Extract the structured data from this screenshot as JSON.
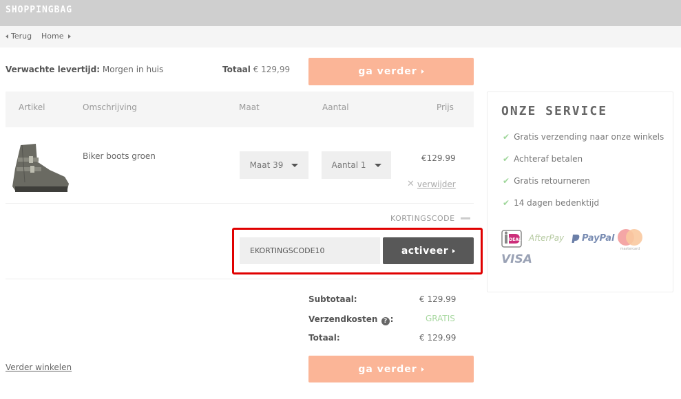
{
  "header": {
    "brand": "SHOPPINGBAG"
  },
  "breadcrumb": {
    "back_label": "Terug",
    "home_label": "Home"
  },
  "delivery": {
    "label": "Verwachte levertijd:",
    "value": " Morgen in huis"
  },
  "top_total": {
    "label": "Totaal",
    "value": " € 129,99"
  },
  "buttons": {
    "continue_label": "ga verder",
    "activate_label": "activeer"
  },
  "table": {
    "headers": [
      "Artikel",
      "Omschrijving",
      "Maat",
      "Aantal",
      "Prijs"
    ],
    "rows": [
      {
        "description": "Biker boots groen",
        "size": "Maat 39",
        "quantity": "Aantal 1",
        "price": "€129.99",
        "remove_label": "verwijder"
      }
    ]
  },
  "discount": {
    "label": "KORTINGSCODE",
    "code_value": "EKORTINGSCODE10"
  },
  "summary": {
    "subtotal_label": "Subtotaal:",
    "subtotal_value": "€ 129.99",
    "shipping_label": "Verzendkosten",
    "shipping_suffix": ":",
    "shipping_value": "GRATIS",
    "total_label": "Totaal:",
    "total_value": "€ 129.99"
  },
  "continue_shopping_label": "Verder winkelen",
  "service": {
    "title": "ONZE SERVICE",
    "items": [
      "Gratis verzending naar onze winkels",
      "Achteraf betalen",
      "Gratis retourneren",
      "14 dagen bedenktijd"
    ]
  },
  "payment_logos": {
    "ideal": "iDEAL",
    "afterpay": "AfterPay",
    "paypal": "PayPal",
    "mastercard": "mastercard",
    "visa": "VISA"
  },
  "colors": {
    "accent_orange": "#fbb597",
    "highlight_red": "#e00000",
    "dark_button": "#585858",
    "check_green": "#9fd69a"
  }
}
